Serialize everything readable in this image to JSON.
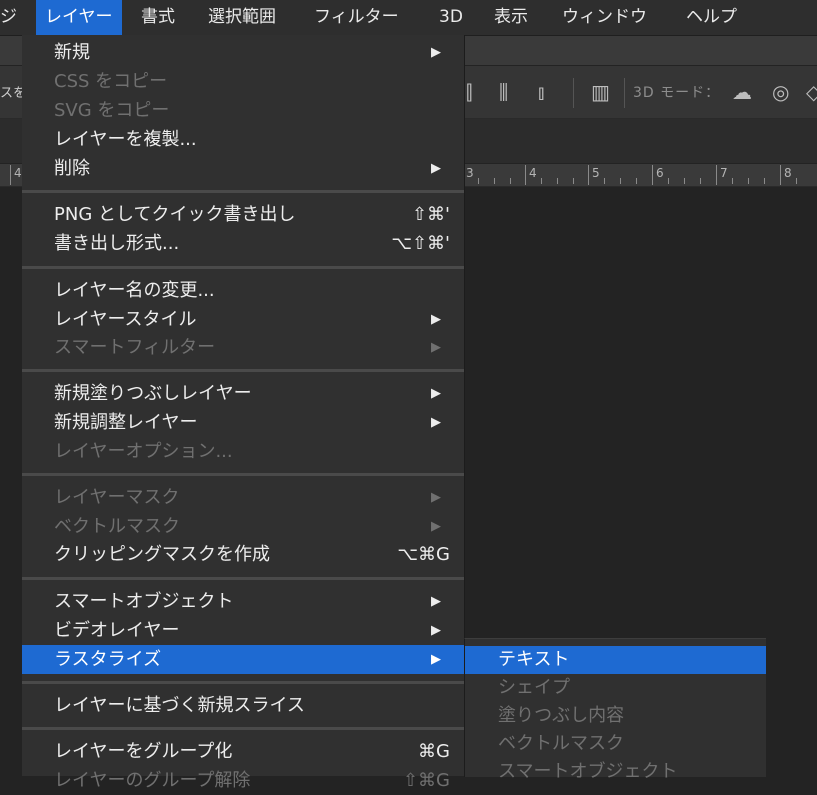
{
  "menubar": {
    "items": [
      {
        "label": "ジ"
      },
      {
        "label": "レイヤー"
      },
      {
        "label": "書式"
      },
      {
        "label": "選択範囲"
      },
      {
        "label": "フィルター"
      },
      {
        "label": "3D"
      },
      {
        "label": "表示"
      },
      {
        "label": "ウィンドウ"
      },
      {
        "label": "ヘルプ"
      }
    ]
  },
  "options_bar": {
    "left_label": "スを",
    "mode_label": "3D モード："
  },
  "ruler": {
    "numbers": [
      "4",
      "3",
      "4",
      "5",
      "6",
      "7",
      "8"
    ]
  },
  "layer_menu": {
    "arrow": "▶",
    "items": [
      {
        "label": "新規",
        "shortcut": "",
        "disabled": false
      },
      {
        "label": "CSS をコピー",
        "shortcut": "",
        "disabled": true
      },
      {
        "label": "SVG をコピー",
        "shortcut": "",
        "disabled": true
      },
      {
        "label": "レイヤーを複製...",
        "shortcut": "",
        "disabled": false
      },
      {
        "label": "削除",
        "shortcut": "",
        "disabled": false
      },
      {
        "label": "PNG としてクイック書き出し",
        "shortcut": "⇧⌘'",
        "disabled": false
      },
      {
        "label": "書き出し形式...",
        "shortcut": "⌥⇧⌘'",
        "disabled": false
      },
      {
        "label": "レイヤー名の変更...",
        "shortcut": "",
        "disabled": false
      },
      {
        "label": "レイヤースタイル",
        "shortcut": "",
        "disabled": false
      },
      {
        "label": "スマートフィルター",
        "shortcut": "",
        "disabled": true
      },
      {
        "label": "新規塗りつぶしレイヤー",
        "shortcut": "",
        "disabled": false
      },
      {
        "label": "新規調整レイヤー",
        "shortcut": "",
        "disabled": false
      },
      {
        "label": "レイヤーオプション...",
        "shortcut": "",
        "disabled": true
      },
      {
        "label": "レイヤーマスク",
        "shortcut": "",
        "disabled": true
      },
      {
        "label": "ベクトルマスク",
        "shortcut": "",
        "disabled": true
      },
      {
        "label": "クリッピングマスクを作成",
        "shortcut": "⌥⌘G",
        "disabled": false
      },
      {
        "label": "スマートオブジェクト",
        "shortcut": "",
        "disabled": false
      },
      {
        "label": "ビデオレイヤー",
        "shortcut": "",
        "disabled": false
      },
      {
        "label": "ラスタライズ",
        "shortcut": "",
        "disabled": false,
        "highlighted": true
      },
      {
        "label": "レイヤーに基づく新規スライス",
        "shortcut": "",
        "disabled": false
      },
      {
        "label": "レイヤーをグループ化",
        "shortcut": "⌘G",
        "disabled": false
      },
      {
        "label": "レイヤーのグループ解除",
        "shortcut": "⇧⌘G",
        "disabled": true
      }
    ]
  },
  "rasterize_submenu": {
    "items": [
      {
        "label": "テキスト",
        "highlighted": true
      },
      {
        "label": "シェイプ",
        "disabled": true
      },
      {
        "label": "塗りつぶし内容",
        "disabled": true
      },
      {
        "label": "ベクトルマスク",
        "disabled": true
      },
      {
        "label": "スマートオブジェクト",
        "disabled": true
      }
    ]
  }
}
